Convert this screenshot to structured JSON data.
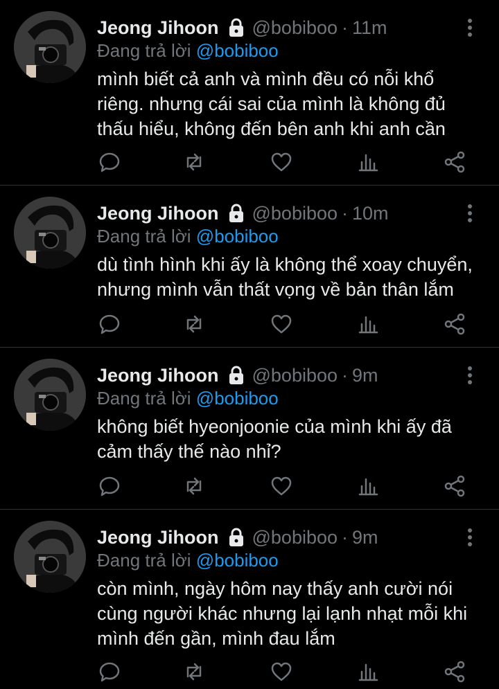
{
  "tweets": [
    {
      "name": "Jeong Jihoon",
      "handle": "@bobiboo",
      "separator": "·",
      "time": "11m",
      "reply_prefix": "Đang trả lời",
      "reply_handle": "@bobiboo",
      "lines": [
        "mình biết cả anh và mình đều có nỗi khổ",
        "riêng. nhưng cái sai của mình là không đủ",
        "thấu hiểu, không đến bên anh khi anh cần"
      ]
    },
    {
      "name": "Jeong Jihoon",
      "handle": "@bobiboo",
      "separator": "·",
      "time": "10m",
      "reply_prefix": "Đang trả lời",
      "reply_handle": "@bobiboo",
      "lines": [
        "dù tình hình khi ấy là không thể xoay chuyển,",
        "nhưng mình vẫn thất vọng về bản thân lắm"
      ]
    },
    {
      "name": "Jeong Jihoon",
      "handle": "@bobiboo",
      "separator": "·",
      "time": "9m",
      "reply_prefix": "Đang trả lời",
      "reply_handle": "@bobiboo",
      "lines": [
        "không biết hyeonjoonie của mình khi ấy đã",
        "cảm thấy thế nào nhỉ?"
      ]
    },
    {
      "name": "Jeong Jihoon",
      "handle": "@bobiboo",
      "separator": "·",
      "time": "9m",
      "reply_prefix": "Đang trả lời",
      "reply_handle": "@bobiboo",
      "lines": [
        "còn mình, ngày hôm nay thấy anh cười nói",
        "cùng người khác nhưng lại lạnh nhạt mỗi khi",
        "mình đến gần, mình đau lắm"
      ]
    }
  ],
  "icons": {
    "lock": "lock-icon",
    "more": "more-vertical-icon",
    "reply": "reply-icon",
    "retweet": "retweet-icon",
    "like": "heart-icon",
    "analytics": "analytics-icon",
    "share": "share-icon"
  },
  "colors": {
    "background": "#000000",
    "text": "#e7e9ea",
    "secondary": "#71767b",
    "accent": "#1d9bf0",
    "divider": "#2f3336"
  }
}
